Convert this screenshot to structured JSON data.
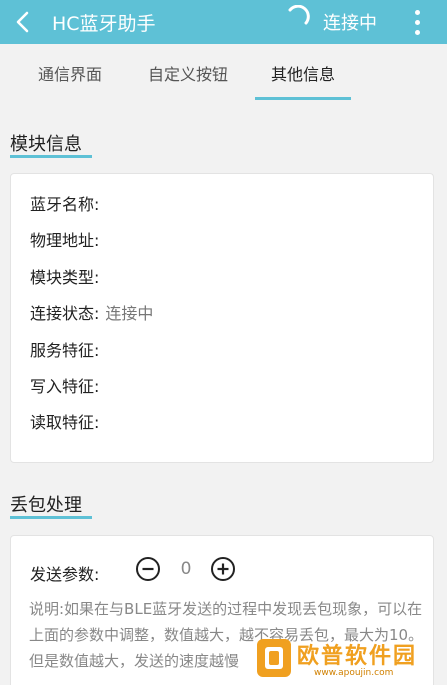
{
  "appbar": {
    "title": "HC蓝牙助手",
    "connection_status": "连接中",
    "icons": [
      "back-icon",
      "spinner-icon",
      "more-vert-icon"
    ]
  },
  "tabs": [
    {
      "label": "通信界面",
      "selected": false
    },
    {
      "label": "自定义按钮",
      "selected": false
    },
    {
      "label": "其他信息",
      "selected": true
    }
  ],
  "module_section": {
    "title": "模块信息",
    "rows": [
      {
        "label": "蓝牙名称:",
        "value": ""
      },
      {
        "label": "物理地址:",
        "value": ""
      },
      {
        "label": "模块类型:",
        "value": ""
      },
      {
        "label": "连接状态:",
        "value": "连接中"
      },
      {
        "label": "服务特征:",
        "value": ""
      },
      {
        "label": "写入特征:",
        "value": ""
      },
      {
        "label": "读取特征:",
        "value": ""
      }
    ]
  },
  "packet_loss_section": {
    "title": "丢包处理",
    "param_label": "发送参数:",
    "param_value": "0",
    "description": "说明:如果在与BLE蓝牙发送的过程中发现丢包现象，可以在上面的参数中调整，数值越大，越不容易丢包，最大为10。但是数值越大，发送的速度越慢"
  },
  "watermark": {
    "text": "欧普软件园",
    "url": "www.apoujin.com"
  },
  "colors": {
    "accent": "#5ec1d6",
    "background": "#f2f2f2",
    "card": "#ffffff",
    "watermark": "#f0a020"
  }
}
